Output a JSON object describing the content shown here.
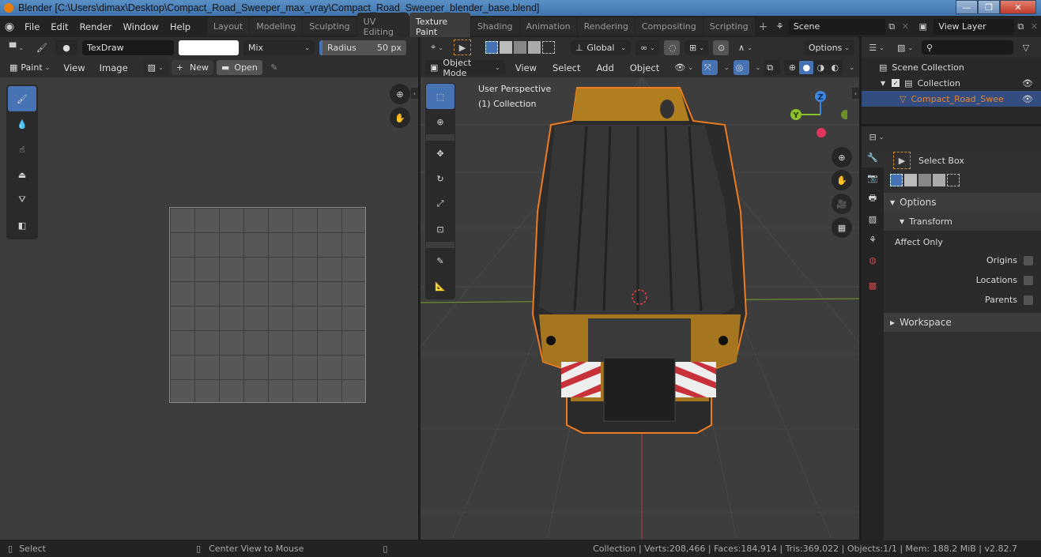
{
  "window": {
    "title": "Blender [C:\\Users\\dimax\\Desktop\\Compact_Road_Sweeper_max_vray\\Compact_Road_Sweeper_blender_base.blend]",
    "controls": {
      "minimize": "—",
      "maximize": "❐",
      "close": "✕"
    }
  },
  "menubar": {
    "items": [
      "File",
      "Edit",
      "Render",
      "Window",
      "Help"
    ]
  },
  "workspaces": {
    "tabs": [
      "Layout",
      "Modeling",
      "Sculpting",
      "UV Editing",
      "Texture Paint",
      "Shading",
      "Animation",
      "Rendering",
      "Compositing",
      "Scripting"
    ],
    "active": "Texture Paint",
    "add": "+"
  },
  "scene": {
    "name": "Scene",
    "view_layer": "View Layer"
  },
  "image_editor": {
    "brush_name": "TexDraw",
    "color": "#ffffff",
    "blend_mode": "Mix",
    "radius_label": "Radius",
    "radius_value": "50 px",
    "mode_label": "Paint",
    "menus": [
      "View",
      "Image"
    ],
    "new_label": "New",
    "open_label": "Open",
    "tools": [
      "draw",
      "soften",
      "smear",
      "clone",
      "fill",
      "mask"
    ]
  },
  "viewport": {
    "transform_orientation": "Global",
    "options_label": "Options",
    "mode": "Object Mode",
    "menus": [
      "View",
      "Select",
      "Add",
      "Object"
    ],
    "perspective_label": "User Perspective",
    "collection_label": "(1) Collection",
    "gizmo": {
      "z": "Z",
      "y": "Y"
    },
    "tools": [
      "select-box",
      "cursor",
      "move",
      "rotate",
      "scale",
      "transform",
      "annotate",
      "measure"
    ]
  },
  "outliner": {
    "search_placeholder": "",
    "items": [
      {
        "label": "Scene Collection",
        "depth": 0
      },
      {
        "label": "Collection",
        "depth": 1
      },
      {
        "label": "Compact_Road_Sweeper",
        "depth": 2,
        "selected": true
      }
    ]
  },
  "properties": {
    "tool_name": "Select Box",
    "options_label": "Options",
    "transform_label": "Transform",
    "affect_only_label": "Affect Only",
    "checks": [
      {
        "label": "Origins",
        "checked": false
      },
      {
        "label": "Locations",
        "checked": false
      },
      {
        "label": "Parents",
        "checked": false
      }
    ],
    "workspace_label": "Workspace"
  },
  "statusbar": {
    "left_action": "Select",
    "mid_action": "Center View to Mouse",
    "stats": "Collection | Verts:208,466 | Faces:184,914 | Tris:369,022 | Objects:1/1 | Mem: 188.2 MiB | v2.82.7"
  },
  "colors": {
    "accent": "#4772b3",
    "selected_object": "#e8832a",
    "axis_x": "#e0365a",
    "axis_y": "#8bc22c",
    "axis_z": "#3c86e0"
  }
}
